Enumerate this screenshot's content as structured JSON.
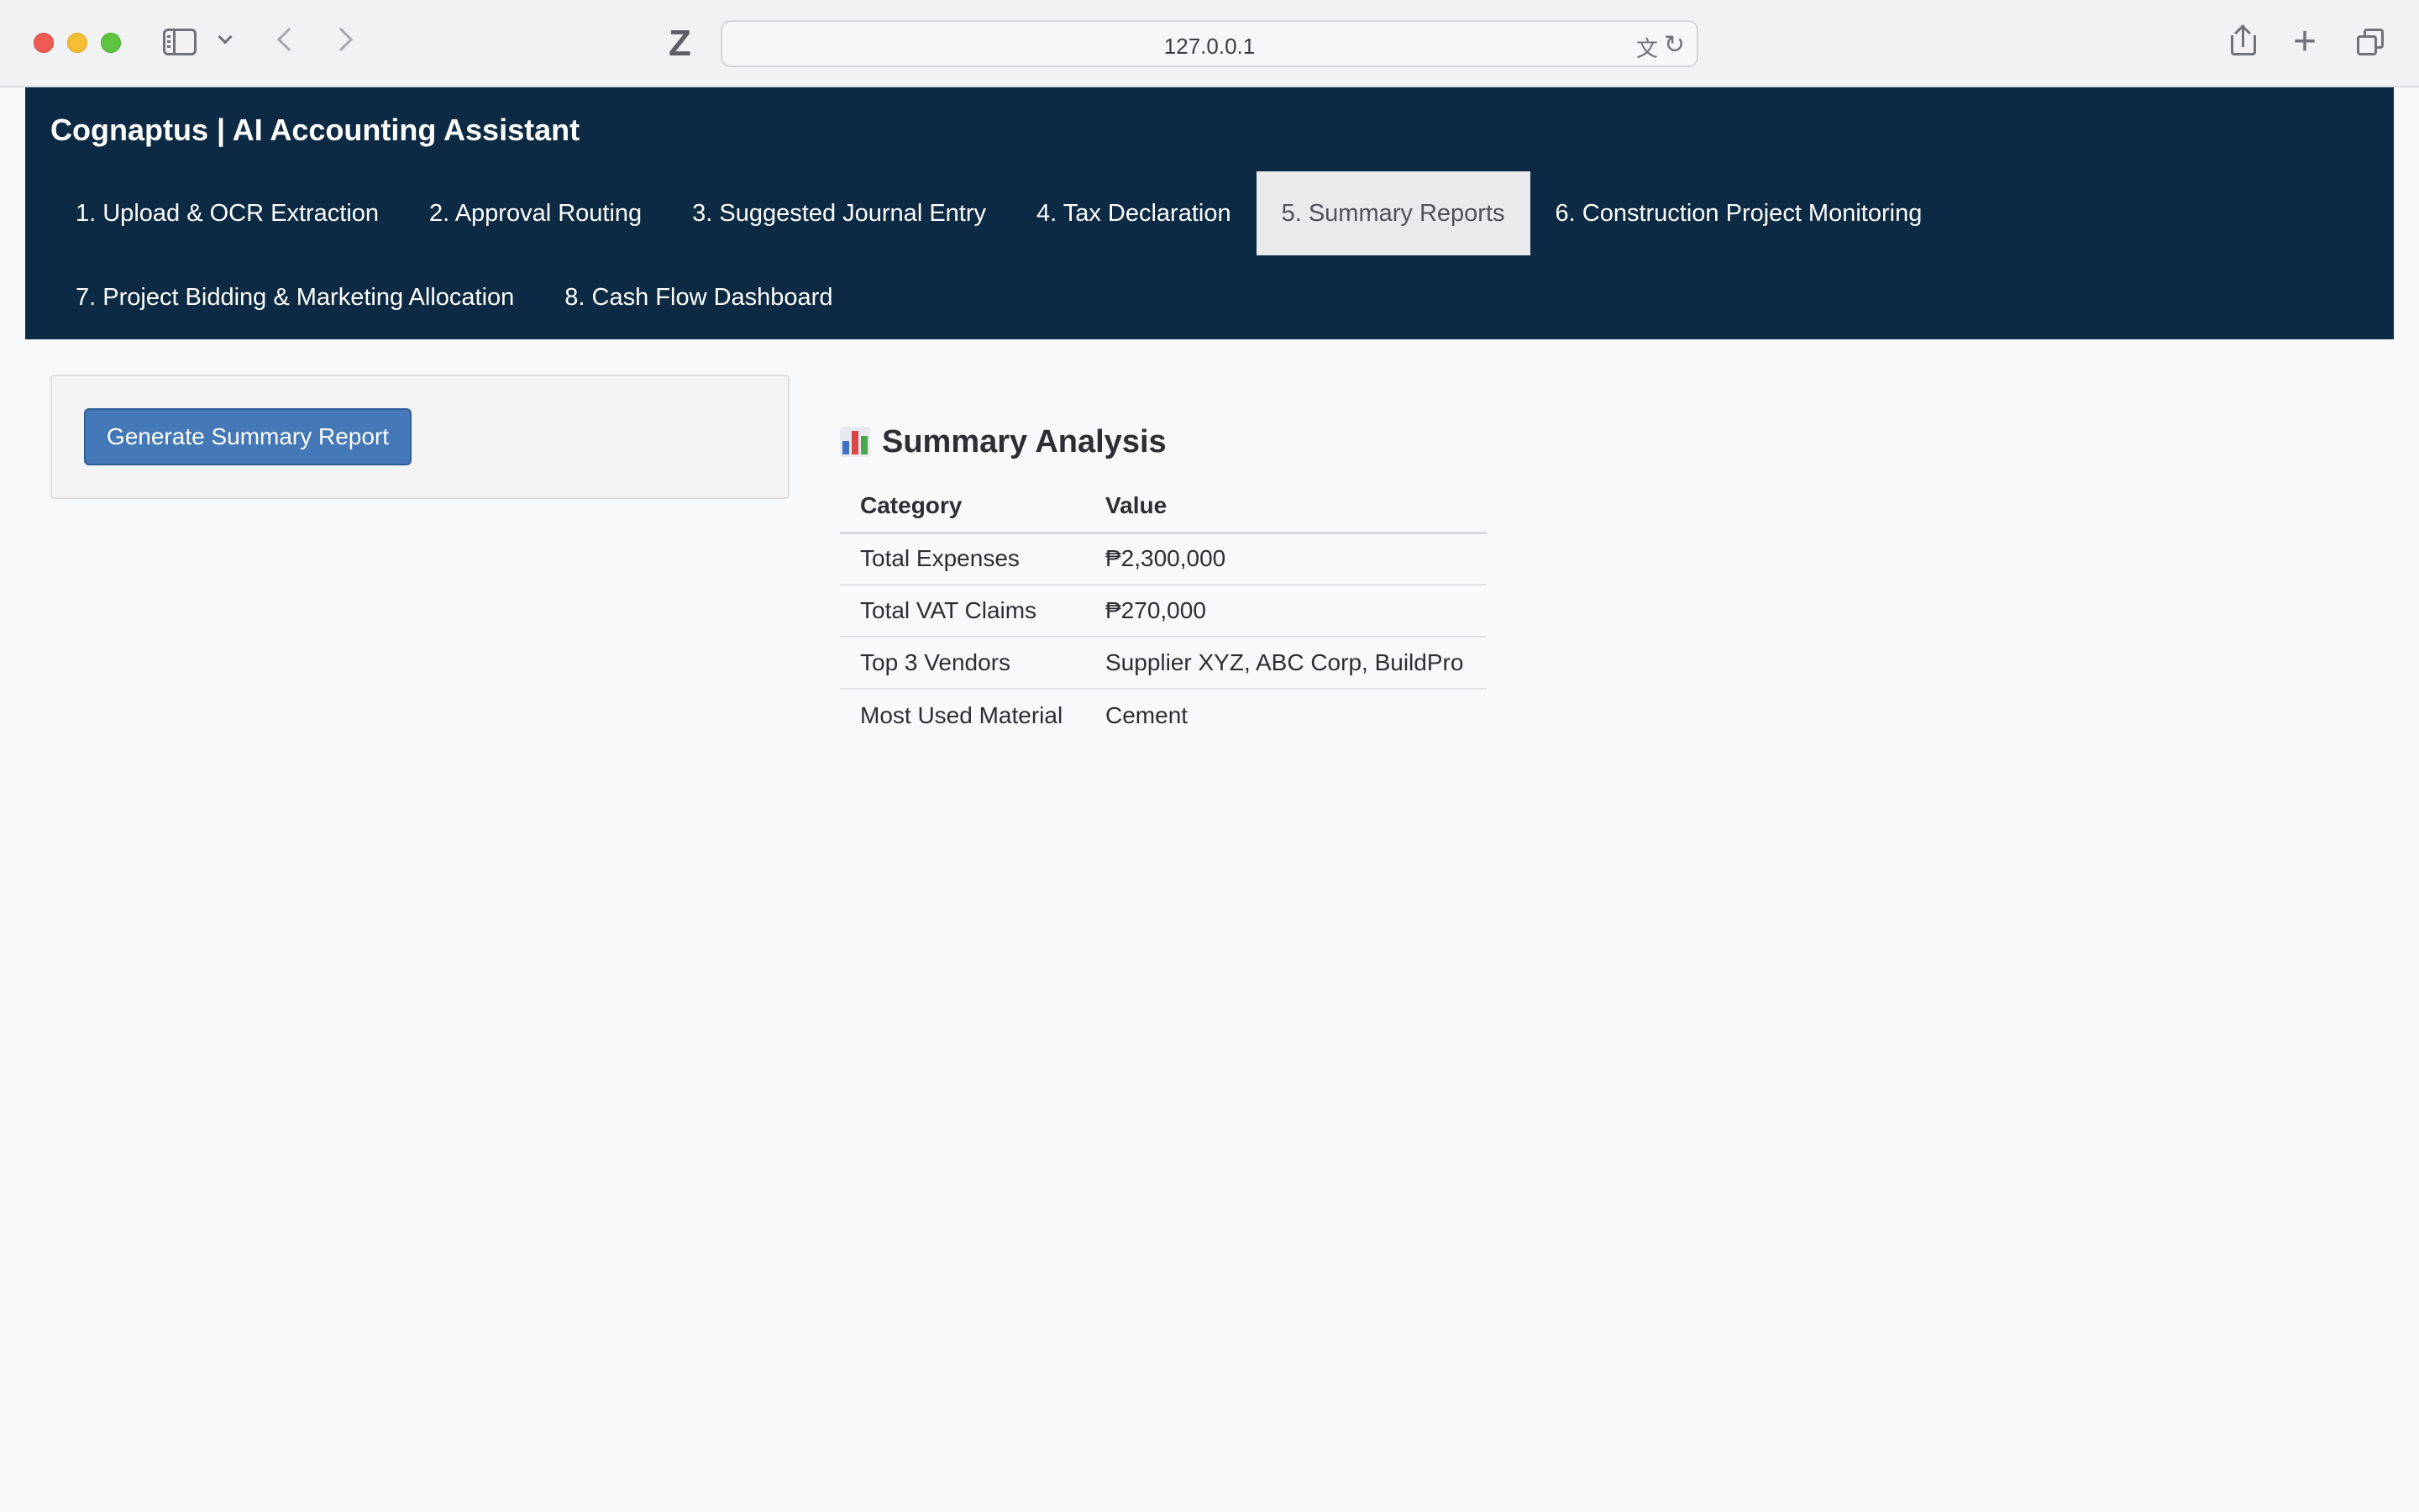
{
  "browser": {
    "url": "127.0.0.1"
  },
  "app": {
    "title": "Cognaptus | AI Accounting Assistant"
  },
  "nav": {
    "row1": [
      {
        "label": "1. Upload & OCR Extraction",
        "active": false
      },
      {
        "label": "2. Approval Routing",
        "active": false
      },
      {
        "label": "3. Suggested Journal Entry",
        "active": false
      },
      {
        "label": "4. Tax Declaration",
        "active": false
      },
      {
        "label": "5. Summary Reports",
        "active": true
      },
      {
        "label": "6. Construction Project Monitoring",
        "active": false
      }
    ],
    "row2": [
      {
        "label": "7. Project Bidding & Marketing Allocation",
        "active": false
      },
      {
        "label": "8. Cash Flow Dashboard",
        "active": false
      }
    ]
  },
  "controls": {
    "generate_label": "Generate Summary Report"
  },
  "analysis": {
    "title": "Summary Analysis",
    "icon": "bar-chart-icon",
    "headers": [
      "Category",
      "Value"
    ],
    "rows": [
      [
        "Total Expenses",
        "₱2,300,000"
      ],
      [
        "Total VAT Claims",
        "₱270,000"
      ],
      [
        "Top 3 Vendors",
        "Supplier XYZ, ABC Corp, BuildPro"
      ],
      [
        "Most Used Material",
        "Cement"
      ]
    ]
  },
  "colors": {
    "header_bg": "#0c2a43",
    "active_tab_bg": "#e9eaeb",
    "button_bg": "#4478b6",
    "page_bg": "#f8f9fa"
  }
}
